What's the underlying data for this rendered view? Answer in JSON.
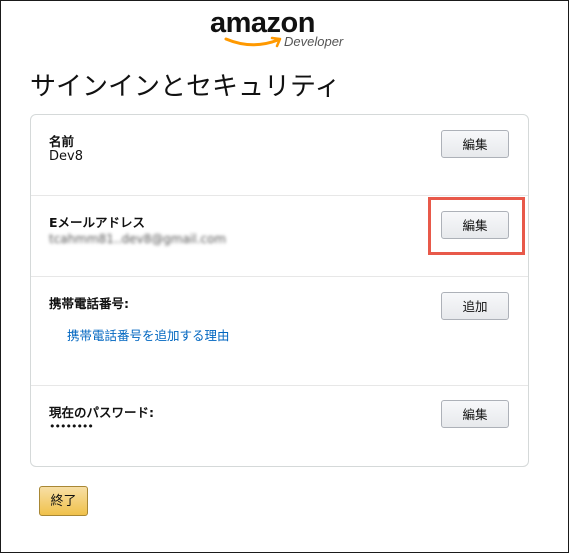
{
  "brand": {
    "wordmark": "amazon",
    "sub": "Developer"
  },
  "page": {
    "title": "サインインとセキュリティ"
  },
  "sections": {
    "name": {
      "label": "名前",
      "value": "Dev8",
      "button": "編集"
    },
    "email": {
      "label": "Eメールアドレス",
      "value": "tcahmm81..dev8@gmail.com",
      "button": "編集"
    },
    "phone": {
      "label": "携帯電話番号:",
      "link": "携帯電話番号を追加する理由",
      "button": "追加"
    },
    "password": {
      "label": "現在のパスワード:",
      "value": "••••••••",
      "button": "編集"
    }
  },
  "footer": {
    "done_label": "終了"
  },
  "colors": {
    "link": "#0066c0",
    "highlight": "#e8594a",
    "primary_button": "#f0c14b"
  }
}
